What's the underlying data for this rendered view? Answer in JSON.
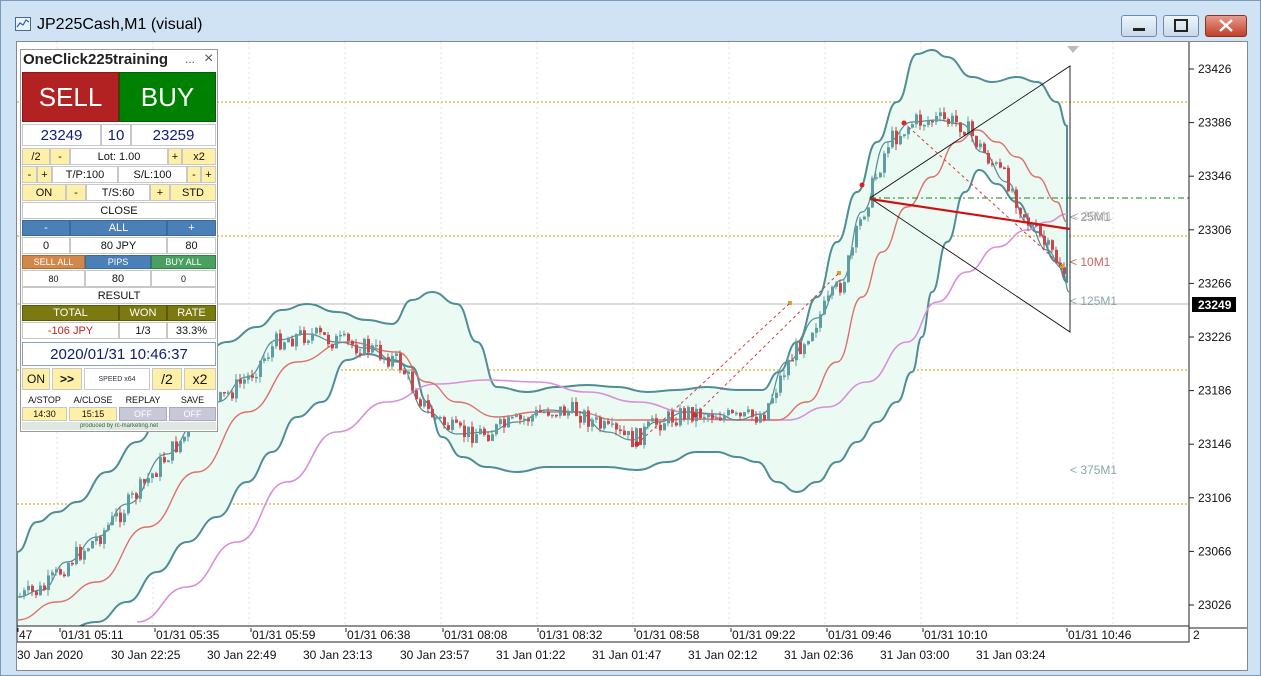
{
  "window": {
    "title": "JP225Cash,M1 (visual)"
  },
  "colors": {
    "bull": "#5f9ea0",
    "bear": "#c8464c",
    "band_fill": "#ecfaf4",
    "ma_red": "#e0706a",
    "ma_pink": "#d890d8",
    "level_line": "#c8a000",
    "trend_red": "#d01010",
    "sell": "#b22222",
    "buy": "#008000"
  },
  "price_axis": {
    "ticks": [
      "23426",
      "23386",
      "23346",
      "23306",
      "23266",
      "23226",
      "23186",
      "23146",
      "23106",
      "23066",
      "23026"
    ],
    "current": "23249"
  },
  "time_axis": {
    "upper": [
      "47",
      "01/31 05:11",
      "01/31 05:35",
      "01/31 05:59",
      "01/31 06:38",
      "01/31 08:08",
      "01/31 08:32",
      "01/31 08:58",
      "01/31 09:22",
      "01/31 09:46",
      "01/31 10:10",
      "01/31 10:46"
    ],
    "lower": [
      "30 Jan 2020",
      "30 Jan 22:25",
      "30 Jan 22:49",
      "30 Jan 23:13",
      "30 Jan 23:57",
      "31 Jan 01:22",
      "31 Jan 01:47",
      "31 Jan 02:12",
      "31 Jan 02:36",
      "31 Jan 03:00",
      "31 Jan 03:24"
    ],
    "right_mark": "2"
  },
  "chart_labels": {
    "ma25": "< 25M1",
    "ma10": "< 10M1",
    "ma125": "< 125M1",
    "ma375": "< 375M1"
  },
  "panel": {
    "title": "OneClick225training",
    "minimize": "...",
    "close": "×",
    "sell": "SELL",
    "buy": "BUY",
    "bid": "23249",
    "spread": "10",
    "ask": "23259",
    "lot_half": "/2",
    "lot_minus": "-",
    "lot": "Lot: 1.00",
    "lot_plus": "+",
    "lot_double": "x2",
    "tp_minus": "-",
    "tp_plus": "+",
    "tp": "T/P:100",
    "sl": "S/L:100",
    "sl_minus": "-",
    "sl_plus": "+",
    "ts_on": "ON",
    "ts_minus": "-",
    "ts": "T/S:60",
    "ts_plus": "+",
    "std": "STD",
    "close_label": "CLOSE",
    "close_minus": "-",
    "close_all": "ALL",
    "close_plus": "+",
    "pos_sell": "0",
    "pos_total": "80 JPY",
    "pos_buy": "80",
    "sell_all": "SELL ALL",
    "pips": "PIPS",
    "buy_all": "BUY ALL",
    "sell_pips": "80",
    "total_pips": "80",
    "buy_pips": "0",
    "result_label": "RESULT",
    "total_label": "TOTAL",
    "won_label": "WON",
    "rate_label": "RATE",
    "total_value": "-106 JPY",
    "won_value": "1/3",
    "rate_value": "33.3%",
    "datetime": "2020/01/31  10:46:37",
    "play_on": "ON",
    "play_ff": ">>",
    "speed": "SPEED x64",
    "speed_half": "/2",
    "speed_double": "x2",
    "astop": "A/STOP",
    "aclose": "A/CLOSE",
    "replay": "REPLAY",
    "save": "SAVE",
    "astop_val": "14:30",
    "aclose_val": "15:15",
    "replay_val": "OFF",
    "save_val": "OFF",
    "footer": "produced by rc-marketing.net"
  }
}
